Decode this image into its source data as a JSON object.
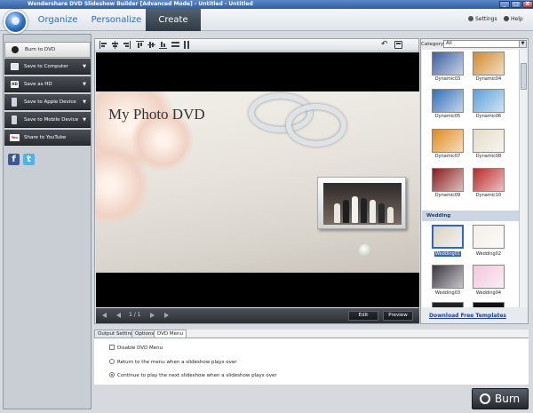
{
  "window": {
    "title": "Wondershare DVD Slideshow Builder [Advanced Mode] - Untitled - Untitled",
    "min": "_",
    "max": "□",
    "close": "X"
  },
  "nav": {
    "tabs": [
      "Organize",
      "Personalize",
      "Create"
    ],
    "active": "Create",
    "settings": "Settings",
    "help": "Help"
  },
  "left": {
    "burn": "Burn to DVD",
    "items": [
      {
        "label": "Save to Computer",
        "icon": "monitor-icon"
      },
      {
        "label": "Save as HD",
        "icon": "hd-icon"
      },
      {
        "label": "Save to Apple Device",
        "icon": "ipod-icon"
      },
      {
        "label": "Save to Mobile Device",
        "icon": "mobile-icon"
      },
      {
        "label": "Share to YouTube",
        "icon": "youtube-icon"
      }
    ],
    "facebook": "f",
    "twitter": "t",
    "youtube_badge": "You"
  },
  "preview": {
    "dvd_title": "My Photo DVD",
    "page": "1 / 1",
    "edit": "Edit",
    "preview": "Preview"
  },
  "right": {
    "category_label": "Category",
    "category_value": "All",
    "dynamic": [
      {
        "label": "Dynamic03",
        "color": "#3b5fa0"
      },
      {
        "label": "Dynamic04",
        "color": "#d08a2a"
      },
      {
        "label": "Dynamic05",
        "color": "#2f6fb8"
      },
      {
        "label": "Dynamic06",
        "color": "#5aa0d8"
      },
      {
        "label": "Dynamic07",
        "color": "#e08a1c"
      },
      {
        "label": "Dynamic08",
        "color": "#e3dcc8"
      },
      {
        "label": "Dynamic09",
        "color": "#8a1c1c"
      },
      {
        "label": "Dynamic10",
        "color": "#b82828"
      }
    ],
    "category_wedding": "Wedding",
    "wedding": [
      {
        "label": "Wedding01",
        "color": "#d9d1c2"
      },
      {
        "label": "Wedding02",
        "color": "#f3eee8"
      },
      {
        "label": "Wedding03",
        "color": "#3a3640"
      },
      {
        "label": "Wedding04",
        "color": "#f2c6dc"
      }
    ],
    "download": "Download Free Templates"
  },
  "bottom": {
    "tabs": [
      "Output Settings",
      "Options",
      "DVD Menu"
    ],
    "active_tab": "DVD Menu",
    "disable_menu": "Disable DVD Menu",
    "return_menu": "Return to the menu when a slideshow plays over",
    "continue_play": "Continue to play the next slideshow when a slideshow plays over",
    "selected_option": "continue_play"
  },
  "burn_button": "Burn"
}
